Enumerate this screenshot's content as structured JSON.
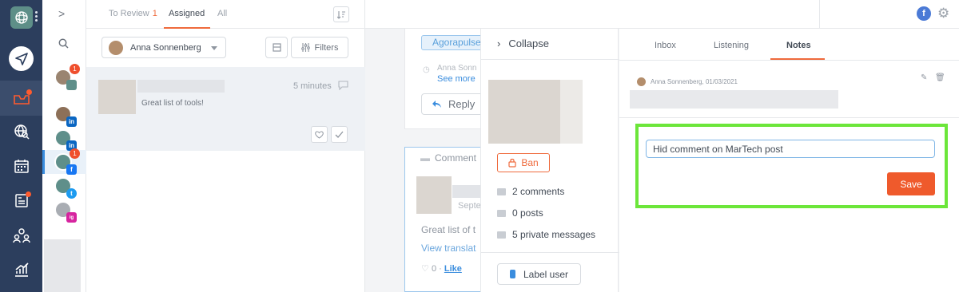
{
  "colors": {
    "rail": "#2c3e5d",
    "accent": "#ef6a3c",
    "link": "#3a8dde",
    "highlight": "#6ce63a",
    "save": "#ef5a2c"
  },
  "profiles": {
    "items": [
      {
        "network": "multi",
        "count": "1"
      },
      {
        "network": "linkedin",
        "label": "in"
      },
      {
        "network": "linkedin",
        "label": "in"
      },
      {
        "network": "facebook",
        "label": "f",
        "count": "1"
      },
      {
        "network": "twitter",
        "label": "t"
      },
      {
        "network": "instagram",
        "label": "ig"
      }
    ]
  },
  "inbox": {
    "tabs": [
      {
        "label": "To Review",
        "count": "1"
      },
      {
        "label": "Assigned"
      },
      {
        "label": "All"
      }
    ],
    "user_filter": "Anna Sonnenberg",
    "filters_label": "Filters",
    "item": {
      "time": "5 minutes",
      "text": "Great list of tools!"
    }
  },
  "feed": {
    "chip": "Agorapulse",
    "author": "Anna Sonn",
    "see_more": "See more",
    "reply": "Reply",
    "comment_header": "Comment",
    "comment_date": "Septe",
    "comment_text": "Great list of t",
    "view_translation": "View translat",
    "likes": "0 ·",
    "like_link": "Like"
  },
  "user_panel": {
    "collapse": "Collapse",
    "ban": "Ban",
    "stats": [
      "2 comments",
      "0 posts",
      "5 private messages"
    ],
    "label_user": "Label user"
  },
  "notes": {
    "tabs": [
      "Inbox",
      "Listening",
      "Notes"
    ],
    "meta": "Anna Sonnenberg, 01/03/2021",
    "input_value": "Hid comment on MarTech post",
    "save": "Save"
  }
}
